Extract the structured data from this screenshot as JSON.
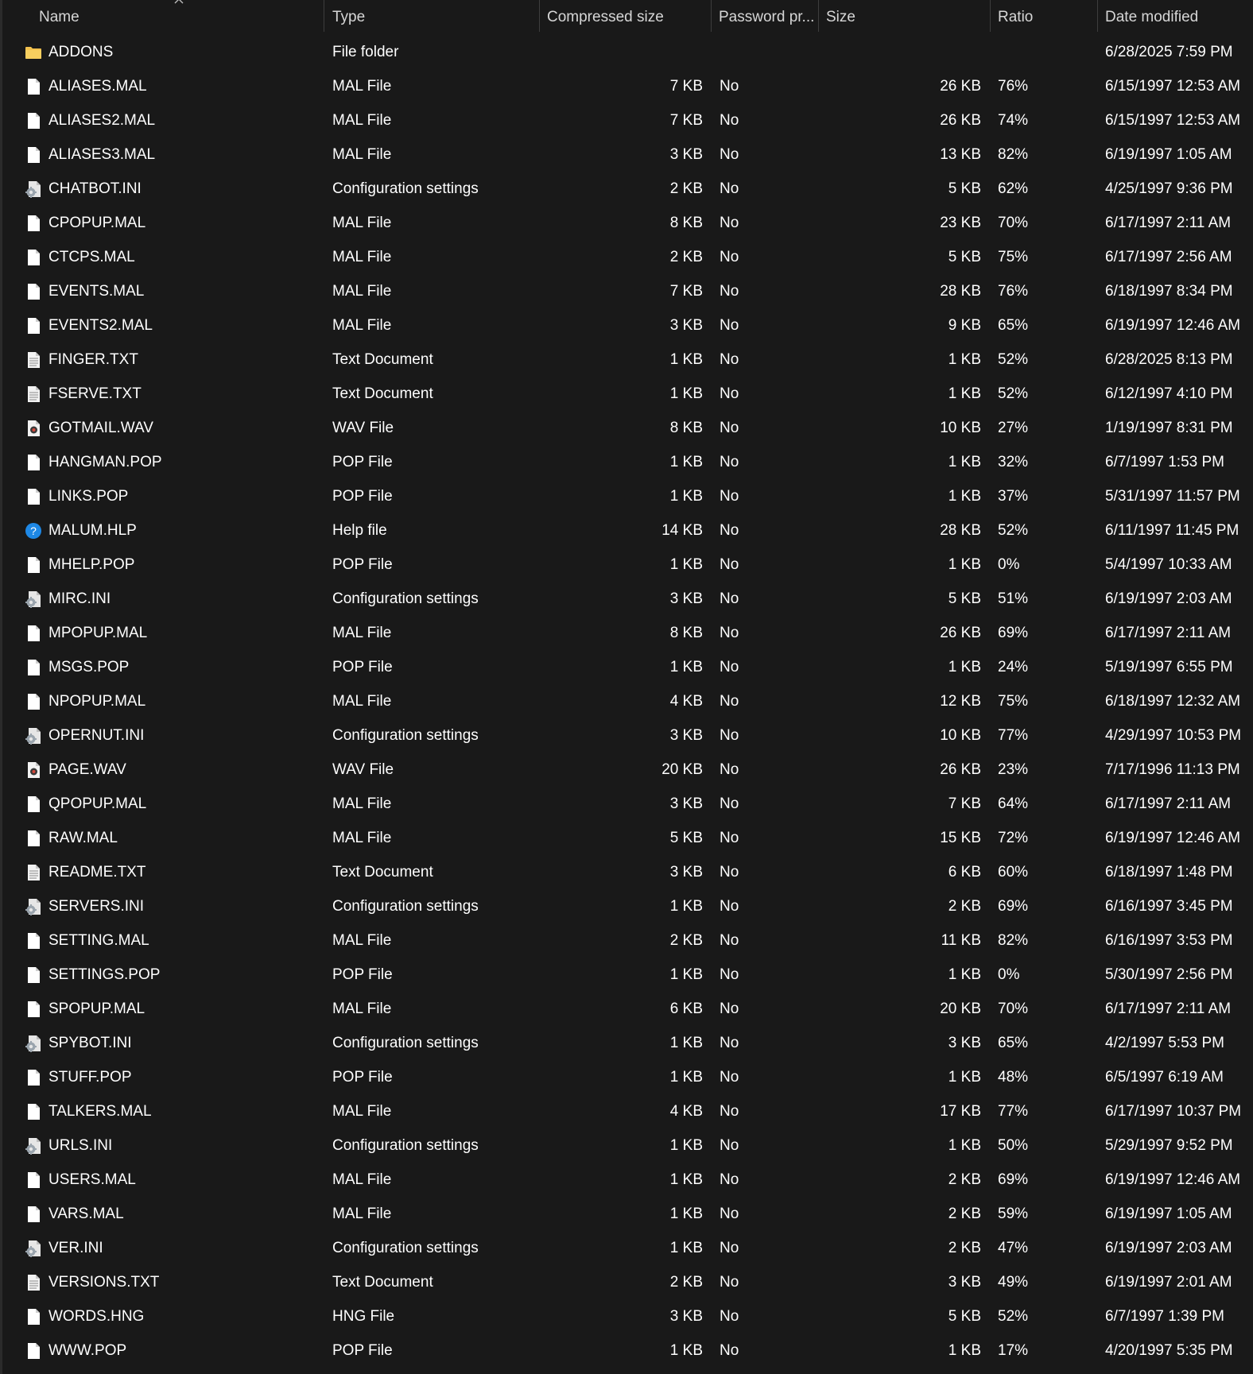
{
  "columns": {
    "name": "Name",
    "type": "Type",
    "compressed_size": "Compressed size",
    "password": "Password pr...",
    "size": "Size",
    "ratio": "Ratio",
    "date_modified": "Date modified"
  },
  "sort": {
    "column": "name",
    "icon": "sort-up-icon"
  },
  "icon_colors": {
    "folder": "#f2c14e",
    "help": "#1e88e5",
    "file": "#ffffff"
  },
  "rows": [
    {
      "icon": "folder-icon",
      "name": "ADDONS",
      "type": "File folder",
      "compressed": "",
      "password": "",
      "size": "",
      "ratio": "",
      "date": "6/28/2025 7:59 PM"
    },
    {
      "icon": "file-icon",
      "name": "ALIASES.MAL",
      "type": "MAL File",
      "compressed": "7 KB",
      "password": "No",
      "size": "26 KB",
      "ratio": "76%",
      "date": "6/15/1997 12:53 AM"
    },
    {
      "icon": "file-icon",
      "name": "ALIASES2.MAL",
      "type": "MAL File",
      "compressed": "7 KB",
      "password": "No",
      "size": "26 KB",
      "ratio": "74%",
      "date": "6/15/1997 12:53 AM"
    },
    {
      "icon": "file-icon",
      "name": "ALIASES3.MAL",
      "type": "MAL File",
      "compressed": "3 KB",
      "password": "No",
      "size": "13 KB",
      "ratio": "82%",
      "date": "6/19/1997 1:05 AM"
    },
    {
      "icon": "config-icon",
      "name": "CHATBOT.INI",
      "type": "Configuration settings",
      "compressed": "2 KB",
      "password": "No",
      "size": "5 KB",
      "ratio": "62%",
      "date": "4/25/1997 9:36 PM"
    },
    {
      "icon": "file-icon",
      "name": "CPOPUP.MAL",
      "type": "MAL File",
      "compressed": "8 KB",
      "password": "No",
      "size": "23 KB",
      "ratio": "70%",
      "date": "6/17/1997 2:11 AM"
    },
    {
      "icon": "file-icon",
      "name": "CTCPS.MAL",
      "type": "MAL File",
      "compressed": "2 KB",
      "password": "No",
      "size": "5 KB",
      "ratio": "75%",
      "date": "6/17/1997 2:56 AM"
    },
    {
      "icon": "file-icon",
      "name": "EVENTS.MAL",
      "type": "MAL File",
      "compressed": "7 KB",
      "password": "No",
      "size": "28 KB",
      "ratio": "76%",
      "date": "6/18/1997 8:34 PM"
    },
    {
      "icon": "file-icon",
      "name": "EVENTS2.MAL",
      "type": "MAL File",
      "compressed": "3 KB",
      "password": "No",
      "size": "9 KB",
      "ratio": "65%",
      "date": "6/19/1997 12:46 AM"
    },
    {
      "icon": "text-file-icon",
      "name": "FINGER.TXT",
      "type": "Text Document",
      "compressed": "1 KB",
      "password": "No",
      "size": "1 KB",
      "ratio": "52%",
      "date": "6/28/2025 8:13 PM"
    },
    {
      "icon": "text-file-icon",
      "name": "FSERVE.TXT",
      "type": "Text Document",
      "compressed": "1 KB",
      "password": "No",
      "size": "1 KB",
      "ratio": "52%",
      "date": "6/12/1997 4:10 PM"
    },
    {
      "icon": "audio-file-icon",
      "name": "GOTMAIL.WAV",
      "type": "WAV File",
      "compressed": "8 KB",
      "password": "No",
      "size": "10 KB",
      "ratio": "27%",
      "date": "1/19/1997 8:31 PM"
    },
    {
      "icon": "file-icon",
      "name": "HANGMAN.POP",
      "type": "POP File",
      "compressed": "1 KB",
      "password": "No",
      "size": "1 KB",
      "ratio": "32%",
      "date": "6/7/1997 1:53 PM"
    },
    {
      "icon": "file-icon",
      "name": "LINKS.POP",
      "type": "POP File",
      "compressed": "1 KB",
      "password": "No",
      "size": "1 KB",
      "ratio": "37%",
      "date": "5/31/1997 11:57 PM"
    },
    {
      "icon": "help-icon",
      "name": "MALUM.HLP",
      "type": "Help file",
      "compressed": "14 KB",
      "password": "No",
      "size": "28 KB",
      "ratio": "52%",
      "date": "6/11/1997 11:45 PM"
    },
    {
      "icon": "file-icon",
      "name": "MHELP.POP",
      "type": "POP File",
      "compressed": "1 KB",
      "password": "No",
      "size": "1 KB",
      "ratio": "0%",
      "date": "5/4/1997 10:33 AM"
    },
    {
      "icon": "config-icon",
      "name": "MIRC.INI",
      "type": "Configuration settings",
      "compressed": "3 KB",
      "password": "No",
      "size": "5 KB",
      "ratio": "51%",
      "date": "6/19/1997 2:03 AM"
    },
    {
      "icon": "file-icon",
      "name": "MPOPUP.MAL",
      "type": "MAL File",
      "compressed": "8 KB",
      "password": "No",
      "size": "26 KB",
      "ratio": "69%",
      "date": "6/17/1997 2:11 AM"
    },
    {
      "icon": "file-icon",
      "name": "MSGS.POP",
      "type": "POP File",
      "compressed": "1 KB",
      "password": "No",
      "size": "1 KB",
      "ratio": "24%",
      "date": "5/19/1997 6:55 PM"
    },
    {
      "icon": "file-icon",
      "name": "NPOPUP.MAL",
      "type": "MAL File",
      "compressed": "4 KB",
      "password": "No",
      "size": "12 KB",
      "ratio": "75%",
      "date": "6/18/1997 12:32 AM"
    },
    {
      "icon": "config-icon",
      "name": "OPERNUT.INI",
      "type": "Configuration settings",
      "compressed": "3 KB",
      "password": "No",
      "size": "10 KB",
      "ratio": "77%",
      "date": "4/29/1997 10:53 PM"
    },
    {
      "icon": "audio-file-icon",
      "name": "PAGE.WAV",
      "type": "WAV File",
      "compressed": "20 KB",
      "password": "No",
      "size": "26 KB",
      "ratio": "23%",
      "date": "7/17/1996 11:13 PM"
    },
    {
      "icon": "file-icon",
      "name": "QPOPUP.MAL",
      "type": "MAL File",
      "compressed": "3 KB",
      "password": "No",
      "size": "7 KB",
      "ratio": "64%",
      "date": "6/17/1997 2:11 AM"
    },
    {
      "icon": "file-icon",
      "name": "RAW.MAL",
      "type": "MAL File",
      "compressed": "5 KB",
      "password": "No",
      "size": "15 KB",
      "ratio": "72%",
      "date": "6/19/1997 12:46 AM"
    },
    {
      "icon": "text-file-icon",
      "name": "README.TXT",
      "type": "Text Document",
      "compressed": "3 KB",
      "password": "No",
      "size": "6 KB",
      "ratio": "60%",
      "date": "6/18/1997 1:48 PM"
    },
    {
      "icon": "config-icon",
      "name": "SERVERS.INI",
      "type": "Configuration settings",
      "compressed": "1 KB",
      "password": "No",
      "size": "2 KB",
      "ratio": "69%",
      "date": "6/16/1997 3:45 PM"
    },
    {
      "icon": "file-icon",
      "name": "SETTING.MAL",
      "type": "MAL File",
      "compressed": "2 KB",
      "password": "No",
      "size": "11 KB",
      "ratio": "82%",
      "date": "6/16/1997 3:53 PM"
    },
    {
      "icon": "file-icon",
      "name": "SETTINGS.POP",
      "type": "POP File",
      "compressed": "1 KB",
      "password": "No",
      "size": "1 KB",
      "ratio": "0%",
      "date": "5/30/1997 2:56 PM"
    },
    {
      "icon": "file-icon",
      "name": "SPOPUP.MAL",
      "type": "MAL File",
      "compressed": "6 KB",
      "password": "No",
      "size": "20 KB",
      "ratio": "70%",
      "date": "6/17/1997 2:11 AM"
    },
    {
      "icon": "config-icon",
      "name": "SPYBOT.INI",
      "type": "Configuration settings",
      "compressed": "1 KB",
      "password": "No",
      "size": "3 KB",
      "ratio": "65%",
      "date": "4/2/1997 5:53 PM"
    },
    {
      "icon": "file-icon",
      "name": "STUFF.POP",
      "type": "POP File",
      "compressed": "1 KB",
      "password": "No",
      "size": "1 KB",
      "ratio": "48%",
      "date": "6/5/1997 6:19 AM"
    },
    {
      "icon": "file-icon",
      "name": "TALKERS.MAL",
      "type": "MAL File",
      "compressed": "4 KB",
      "password": "No",
      "size": "17 KB",
      "ratio": "77%",
      "date": "6/17/1997 10:37 PM"
    },
    {
      "icon": "config-icon",
      "name": "URLS.INI",
      "type": "Configuration settings",
      "compressed": "1 KB",
      "password": "No",
      "size": "1 KB",
      "ratio": "50%",
      "date": "5/29/1997 9:52 PM"
    },
    {
      "icon": "file-icon",
      "name": "USERS.MAL",
      "type": "MAL File",
      "compressed": "1 KB",
      "password": "No",
      "size": "2 KB",
      "ratio": "69%",
      "date": "6/19/1997 12:46 AM"
    },
    {
      "icon": "file-icon",
      "name": "VARS.MAL",
      "type": "MAL File",
      "compressed": "1 KB",
      "password": "No",
      "size": "2 KB",
      "ratio": "59%",
      "date": "6/19/1997 1:05 AM"
    },
    {
      "icon": "config-icon",
      "name": "VER.INI",
      "type": "Configuration settings",
      "compressed": "1 KB",
      "password": "No",
      "size": "2 KB",
      "ratio": "47%",
      "date": "6/19/1997 2:03 AM"
    },
    {
      "icon": "text-file-icon",
      "name": "VERSIONS.TXT",
      "type": "Text Document",
      "compressed": "2 KB",
      "password": "No",
      "size": "3 KB",
      "ratio": "49%",
      "date": "6/19/1997 2:01 AM"
    },
    {
      "icon": "file-icon",
      "name": "WORDS.HNG",
      "type": "HNG File",
      "compressed": "3 KB",
      "password": "No",
      "size": "5 KB",
      "ratio": "52%",
      "date": "6/7/1997 1:39 PM"
    },
    {
      "icon": "file-icon",
      "name": "WWW.POP",
      "type": "POP File",
      "compressed": "1 KB",
      "password": "No",
      "size": "1 KB",
      "ratio": "17%",
      "date": "4/20/1997 5:35 PM"
    }
  ]
}
